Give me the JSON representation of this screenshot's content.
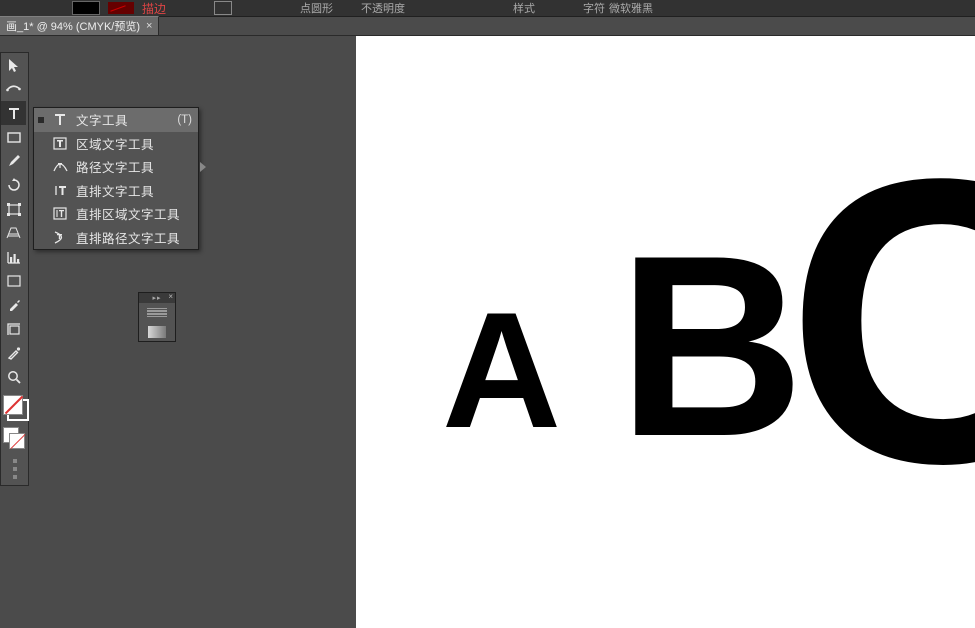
{
  "topbar": {
    "swatch_label": "描边",
    "opacity_label": "不透明度",
    "style_label": "样式",
    "font_label": "字符",
    "font_value": "微软雅黑",
    "point_label": "点圆形"
  },
  "document": {
    "tab_title": "画_1* @ 94% (CMYK/预览)"
  },
  "tool_flyout": {
    "items": [
      {
        "label": "文字工具",
        "shortcut": "(T)",
        "icon": "type-icon",
        "selected": true
      },
      {
        "label": "区域文字工具",
        "shortcut": "",
        "icon": "area-type-icon",
        "selected": false
      },
      {
        "label": "路径文字工具",
        "shortcut": "",
        "icon": "path-type-icon",
        "selected": false
      },
      {
        "label": "直排文字工具",
        "shortcut": "",
        "icon": "vertical-type-icon",
        "selected": false
      },
      {
        "label": "直排区域文字工具",
        "shortcut": "",
        "icon": "vertical-area-type-icon",
        "selected": false
      },
      {
        "label": "直排路径文字工具",
        "shortcut": "",
        "icon": "vertical-path-type-icon",
        "selected": false
      }
    ]
  },
  "canvas": {
    "text_A": "A",
    "text_B": "B",
    "text_C": "C"
  }
}
